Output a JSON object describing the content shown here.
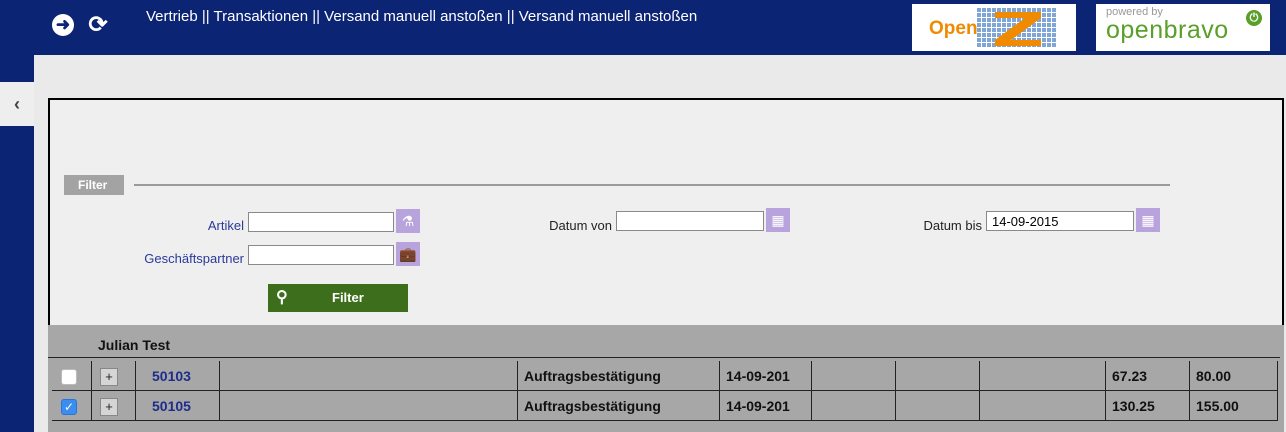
{
  "header": {
    "back_icon": "arrow-left-circle-icon",
    "refresh_icon": "refresh-icon",
    "title": "Vertrieb || Transaktionen || Versand manuell anstoßen  ||  Versand manuell anstoßen",
    "logo_openz": {
      "text": "Open",
      "letter": "Z"
    },
    "logo_openbravo": {
      "powered": "powered by",
      "brand": "openbravo"
    }
  },
  "filter": {
    "section_label": "Filter",
    "artikel_label": "Artikel",
    "artikel_value": "",
    "geschaeftspartner_label": "Geschäftspartner",
    "geschaeftspartner_value": "",
    "datum_von_label": "Datum von",
    "datum_von_value": "",
    "datum_bis_label": "Datum bis",
    "datum_bis_value": "14-09-2015",
    "button_label": "Filter"
  },
  "grid": {
    "groups": [
      {
        "name": "Julian Test",
        "rows": [
          {
            "checked": false,
            "number": "50103",
            "empty1": "",
            "doc_type": "Auftragsbestätigung",
            "date": "14-09-201",
            "empty2": "",
            "empty3": "",
            "empty4": "",
            "empty5": "",
            "amount_net": "67.23",
            "amount_gross": "80.00"
          },
          {
            "checked": true,
            "number": "50105",
            "empty1": "",
            "doc_type": "Auftragsbestätigung",
            "date": "14-09-201",
            "empty2": "",
            "empty3": "",
            "empty4": "",
            "empty5": "",
            "amount_net": "130.25",
            "amount_gross": "155.00"
          }
        ]
      }
    ]
  },
  "colors": {
    "header_bg": "#0c2474",
    "filter_button_bg": "#3d6e1c",
    "icon_button_bg": "#b9a3dc"
  }
}
